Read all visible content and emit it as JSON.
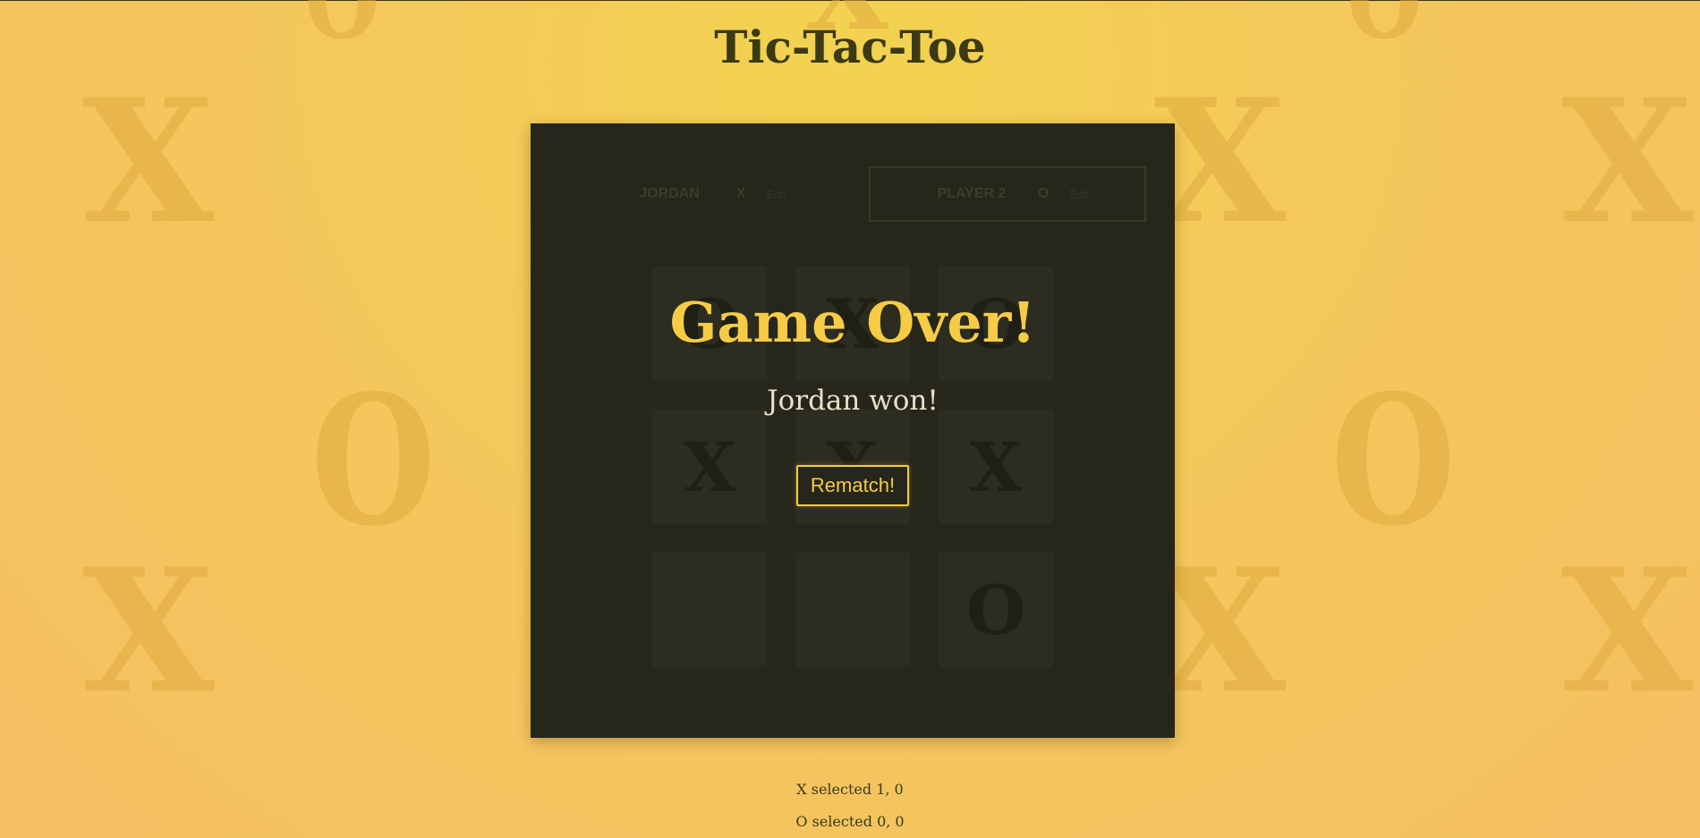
{
  "page": {
    "title": "Tic-Tac-Toe",
    "colors": {
      "background": "#f4c95a",
      "panel": "#26261a",
      "accent": "#f6cc46",
      "title": "#3b3a12"
    }
  },
  "players": [
    {
      "name": "Jordan",
      "symbol": "X",
      "edit_label": "Edit",
      "active": false
    },
    {
      "name": "Player 2",
      "symbol": "O",
      "edit_label": "Edit",
      "active": true
    }
  ],
  "board": [
    [
      "O",
      "X",
      "O"
    ],
    [
      "X",
      "X",
      "X"
    ],
    [
      "",
      "",
      "O"
    ]
  ],
  "game_over": {
    "heading": "Game Over!",
    "message": "Jordan won!",
    "rematch_label": "Rematch!"
  },
  "log": [
    "X selected 1, 0",
    "O selected 0, 0"
  ],
  "background_marks": {
    "icons": [
      "x-mark-icon",
      "o-mark-icon"
    ]
  }
}
